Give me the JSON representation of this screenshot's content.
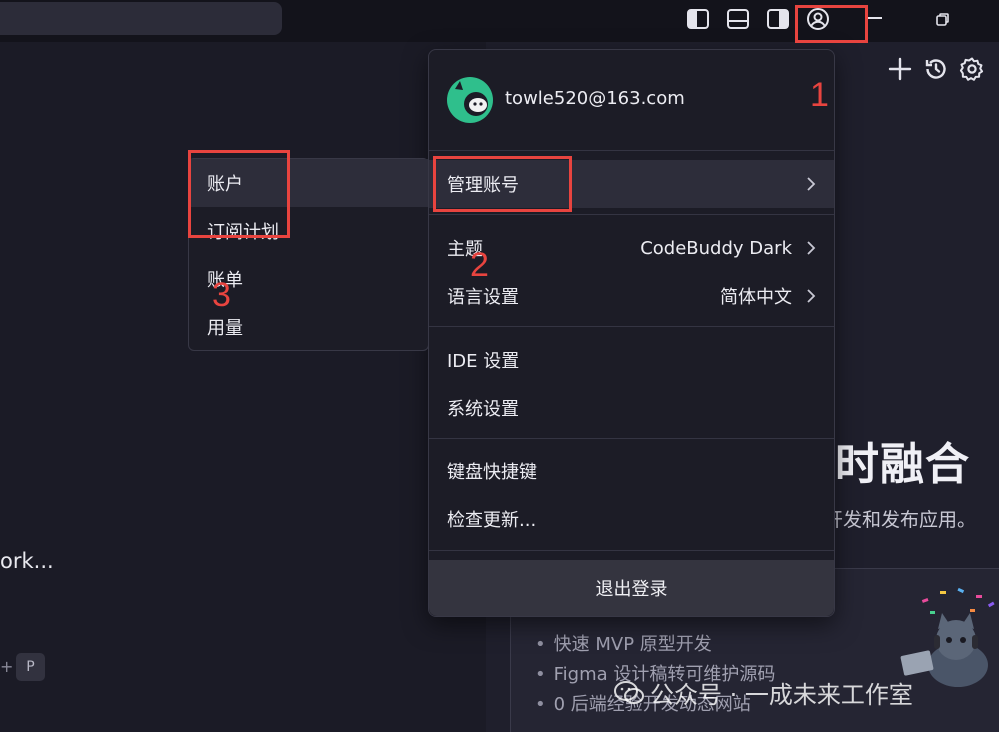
{
  "left": {
    "snippet": "ork...",
    "shortcut_plus": "+",
    "shortcut_key": "P"
  },
  "popup": {
    "email": "towle520@163.com",
    "manage_account": "管理账号",
    "theme_label": "主题",
    "theme_value": "CodeBuddy Dark",
    "language_label": "语言设置",
    "language_value": "简体中文",
    "ide_settings": "IDE 设置",
    "system_settings": "系统设置",
    "shortcuts": "键盘快捷键",
    "check_updates": "检查更新...",
    "logout": "退出登录"
  },
  "submenu": {
    "items": [
      "账户",
      "订阅计划",
      "账单",
      "用量"
    ]
  },
  "hero": {
    "title": "时融合",
    "subtitle": "开发和发布应用。"
  },
  "features": [
    "快速 MVP 原型开发",
    "Figma 设计稿转可维护源码",
    "0 后端经验开发动态网站"
  ],
  "annotations": {
    "n1": "1",
    "n2": "2",
    "n3": "3"
  },
  "watermark": "公众号 · 一成未来工作室",
  "colors": {
    "annotation": "#e8443f",
    "avatar_green": "#2fbf8c",
    "popup_bg": "#1c1c26"
  },
  "icons": [
    "toggle-left-panel-icon",
    "toggle-bottom-panel-icon",
    "toggle-right-panel-icon",
    "user-account-icon",
    "minimize-icon",
    "restore-icon",
    "plus-icon",
    "history-icon",
    "settings-gear-icon",
    "chevron-right-icon",
    "wechat-icon"
  ]
}
